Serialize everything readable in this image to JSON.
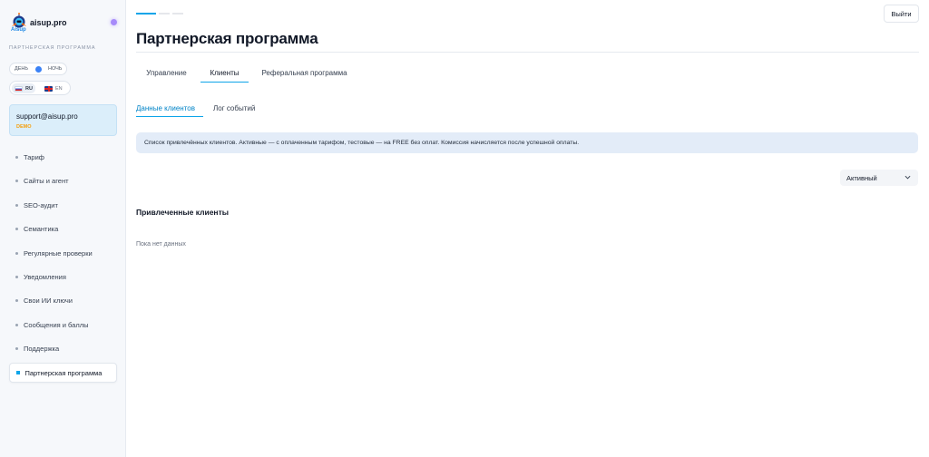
{
  "brand": {
    "name": "aisup.pro",
    "sub": "Aisup"
  },
  "sidebar": {
    "section_caption": "Партнерская программа",
    "theme": {
      "day": "ДЕНЬ",
      "night": "НОЧЬ"
    },
    "languages": [
      {
        "code": "RU",
        "selected": true
      },
      {
        "code": "EN",
        "selected": false
      }
    ],
    "account": {
      "email": "support@aisup.pro",
      "plan": "DEMO"
    },
    "items": [
      {
        "label": "Тариф"
      },
      {
        "label": "Сайты и агент"
      },
      {
        "label": "SEO-аудит"
      },
      {
        "label": "Семантика"
      },
      {
        "label": "Регулярные проверки"
      },
      {
        "label": "Уведомления"
      },
      {
        "label": "Свои ИИ ключи"
      },
      {
        "label": "Сообщения и баллы"
      },
      {
        "label": "Поддержка"
      },
      {
        "label": "Партнерская программа",
        "active": true
      }
    ]
  },
  "header": {
    "logout_label": "Выйти",
    "title": "Партнерская программа"
  },
  "tabs": [
    {
      "label": "Управление"
    },
    {
      "label": "Клиенты",
      "active": true
    },
    {
      "label": "Реферальная программа"
    }
  ],
  "subtabs": [
    {
      "label": "Данные клиентов",
      "active": true
    },
    {
      "label": "Лог событий"
    }
  ],
  "info_banner": "Список привлечённых клиентов. Активные — с оплаченным тарифом, тестовые — на FREE без оплат. Комиссия начисляется после успешной оплаты.",
  "filter": {
    "status_value": "Активный"
  },
  "clients": {
    "title": "Привлеченные клиенты",
    "empty_text": "Пока нет данных"
  },
  "colors": {
    "accent": "#0ea5e9",
    "banner_bg": "#e3ecf8",
    "account_card_bg": "#dbeefa",
    "plan_badge": "#f59e0b"
  }
}
